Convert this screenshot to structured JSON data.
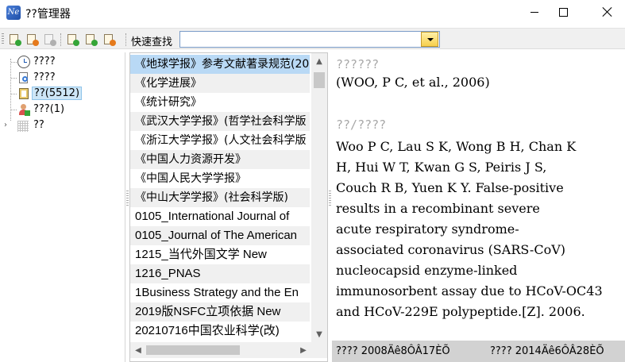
{
  "window": {
    "icon_text": "Ne",
    "title": "??管理器"
  },
  "toolbar": {
    "quick_search_label": "快速查找",
    "quick_search_value": ""
  },
  "tree": {
    "items": [
      {
        "label": "????",
        "icon": "clock-icon"
      },
      {
        "label": "????",
        "icon": "search-doc-icon"
      },
      {
        "label": "??(5512)",
        "icon": "library-icon",
        "selected": true
      },
      {
        "label": "???(1)",
        "icon": "user-add-icon"
      },
      {
        "label": "??",
        "icon": "grid-icon",
        "expander": "›"
      }
    ]
  },
  "list": {
    "items": [
      {
        "label": "《地球学报》参考文献著录规范(20",
        "selected": true
      },
      {
        "label": "《化学进展》"
      },
      {
        "label": "《统计研究》"
      },
      {
        "label": "《武汉大学学报》(哲学社会科学版"
      },
      {
        "label": "《浙江大学学报》(人文社会科学版"
      },
      {
        "label": "《中国人力资源开发》"
      },
      {
        "label": "《中国人民大学学报》"
      },
      {
        "label": "《中山大学学报》(社会科学版)"
      },
      {
        "label": "0105_International Journal of"
      },
      {
        "label": "0105_Journal of The American"
      },
      {
        "label": "1215_当代外国文学 New"
      },
      {
        "label": "1216_PNAS"
      },
      {
        "label": "1Business Strategy and the En"
      },
      {
        "label": "2019版NSFC立项依据 New"
      },
      {
        "label": "20210716中国农业科学(改)"
      }
    ]
  },
  "detail": {
    "citation_heading": "??????",
    "citation": "(WOO, P C, et al., 2006)",
    "reference_heading": "??/????",
    "reference_lines": [
      "Woo P C, Lau S K, Wong B H, Chan K",
      "H, Hui W T, Kwan G S, Peiris J S,",
      "Couch R B, Yuen K Y. False-positive",
      "results in a recombinant severe",
      "acute respiratory syndrome-",
      "associated coronavirus (SARS-CoV)",
      "nucleocapsid enzyme-linked",
      "immunosorbent assay due to HCoV-OC43",
      "and HCoV-229E polypeptide.[Z]. 2006."
    ]
  },
  "status": {
    "created": "????  2008Äê8ÔÂ17ÈÕ",
    "modified": "????  2014Äê6ÔÂ28ÈÕ"
  }
}
